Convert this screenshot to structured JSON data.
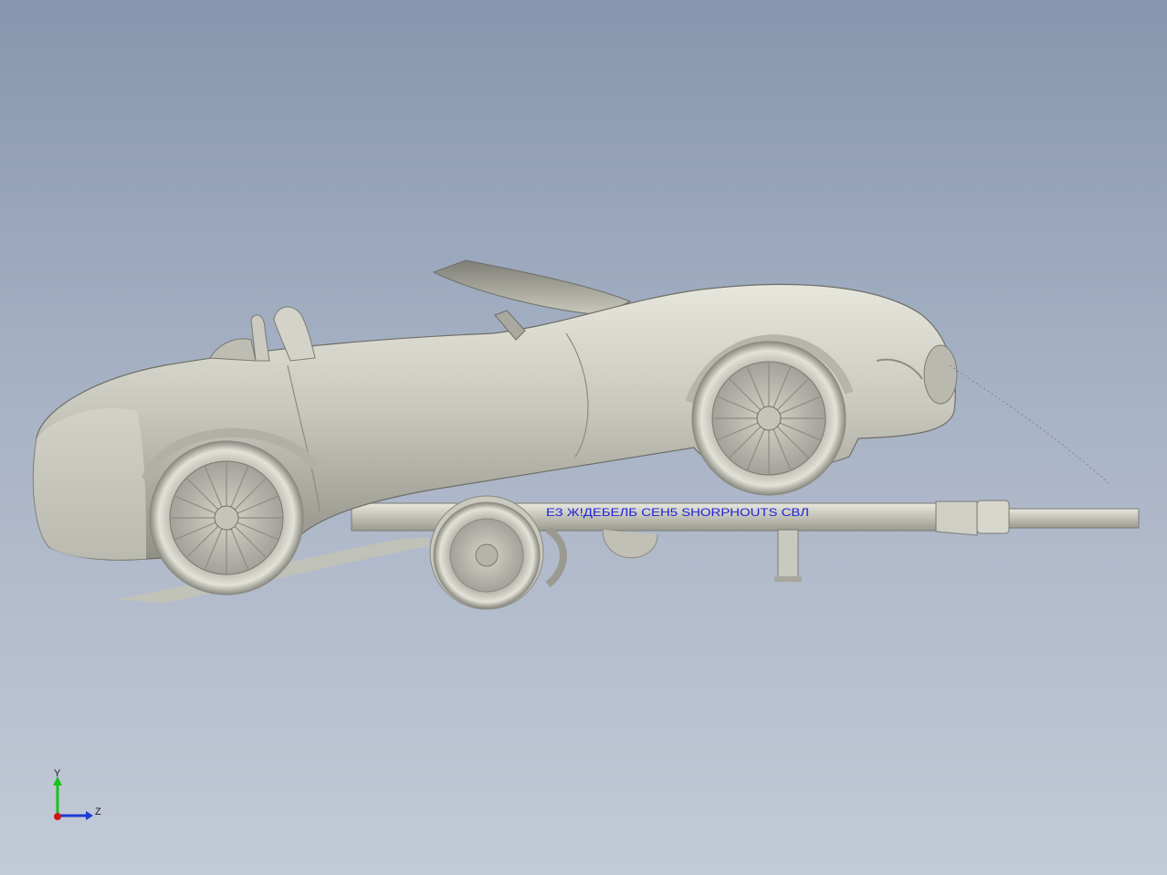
{
  "viewport": {
    "background_top": "#8796ae",
    "background_bottom": "#c3cad7",
    "model_color": "#c6c6bc"
  },
  "annotation": {
    "text": "ЕЗ Ж!ДЕБЕЛБ СЕН5 SHORPHOUTS СВЛ",
    "color": "#1b22d8"
  },
  "triad": {
    "y_label": "Y",
    "z_label": "Z",
    "y_color": "#19c21a",
    "z_color": "#1b3ad6",
    "x_color": "#d01818"
  }
}
